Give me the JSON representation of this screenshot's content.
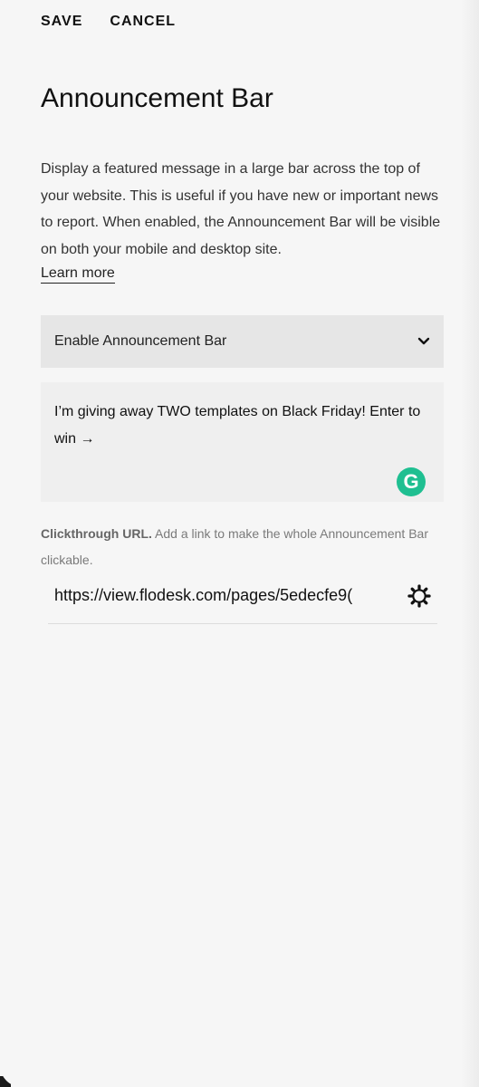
{
  "header": {
    "save_label": "SAVE",
    "cancel_label": "CANCEL"
  },
  "page": {
    "title": "Announcement Bar",
    "description": "Display a featured message in a large bar across the top of your website. This is useful if you have new or important news to report. When enabled, the Announcement Bar will be visible on both your mobile and desktop site.",
    "learn_more": "Learn more"
  },
  "toggle": {
    "label": "Enable Announcement Bar",
    "icon": "chevron-down-icon"
  },
  "message": {
    "value": "I’m giving away TWO templates on Black Friday!  Enter to win →",
    "grammarly_glyph": "G"
  },
  "clickthrough": {
    "label": "Clickthrough URL.",
    "help": "Add a link to make the whole Announcement Bar clickable.",
    "value": "https://view.flodesk.com/pages/5edecfe9("
  },
  "colors": {
    "background": "#f6f6f6",
    "toggle_bg": "#e6e6e6",
    "textbox_bg": "#efefef",
    "grammarly": "#1fbf91"
  }
}
